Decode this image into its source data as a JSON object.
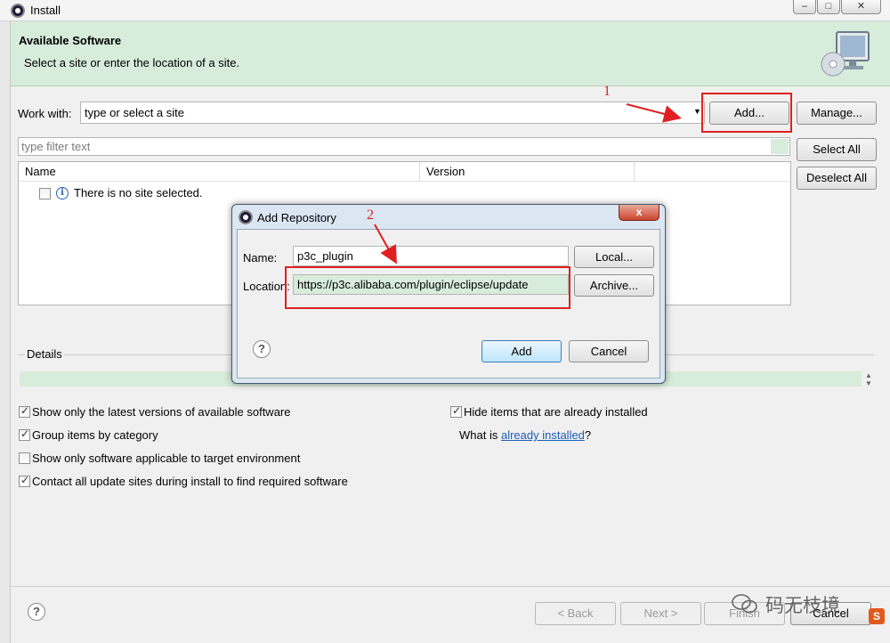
{
  "window": {
    "title": "Install"
  },
  "header": {
    "title": "Available Software",
    "subtitle": "Select a site or enter the location of a site."
  },
  "work_with": {
    "label": "Work with:",
    "value": "type or select a site",
    "add_button": "Add...",
    "manage_button": "Manage..."
  },
  "filter": {
    "placeholder": "type filter text"
  },
  "side_buttons": {
    "select_all": "Select All",
    "deselect_all": "Deselect All"
  },
  "table": {
    "columns": [
      "Name",
      "Version"
    ],
    "rows": [
      {
        "name": "There is no site selected.",
        "checked": false
      }
    ]
  },
  "details": {
    "label": "Details"
  },
  "options": {
    "show_latest": {
      "label": "Show only the latest versions of available software",
      "checked": true
    },
    "group_by_category": {
      "label": "Group items by category",
      "checked": true
    },
    "applicable_only": {
      "label": "Show only software applicable to target environment",
      "checked": false
    },
    "contact_sites": {
      "label": "Contact all update sites during install to find required software",
      "checked": true
    },
    "hide_installed": {
      "label": "Hide items that are already installed",
      "checked": true
    },
    "what_is_prefix": "What is",
    "what_is_link": "already installed",
    "what_is_suffix": "?"
  },
  "footer": {
    "back_button": "< Back",
    "next_button": "Next >",
    "finish_button": "Finish",
    "cancel_button": "Cancel"
  },
  "dialog": {
    "title": "Add Repository",
    "close_glyph": "x",
    "name_label": "Name:",
    "name_value": "p3c_plugin",
    "location_label": "Location:",
    "location_value": "https://p3c.alibaba.com/plugin/eclipse/update",
    "local_button": "Local...",
    "archive_button": "Archive...",
    "add_button": "Add",
    "cancel_button": "Cancel"
  },
  "annotations": {
    "step1": "1",
    "step2": "2",
    "color": "#e02020"
  },
  "watermark": {
    "text": "码无枝境",
    "badge": "S"
  }
}
